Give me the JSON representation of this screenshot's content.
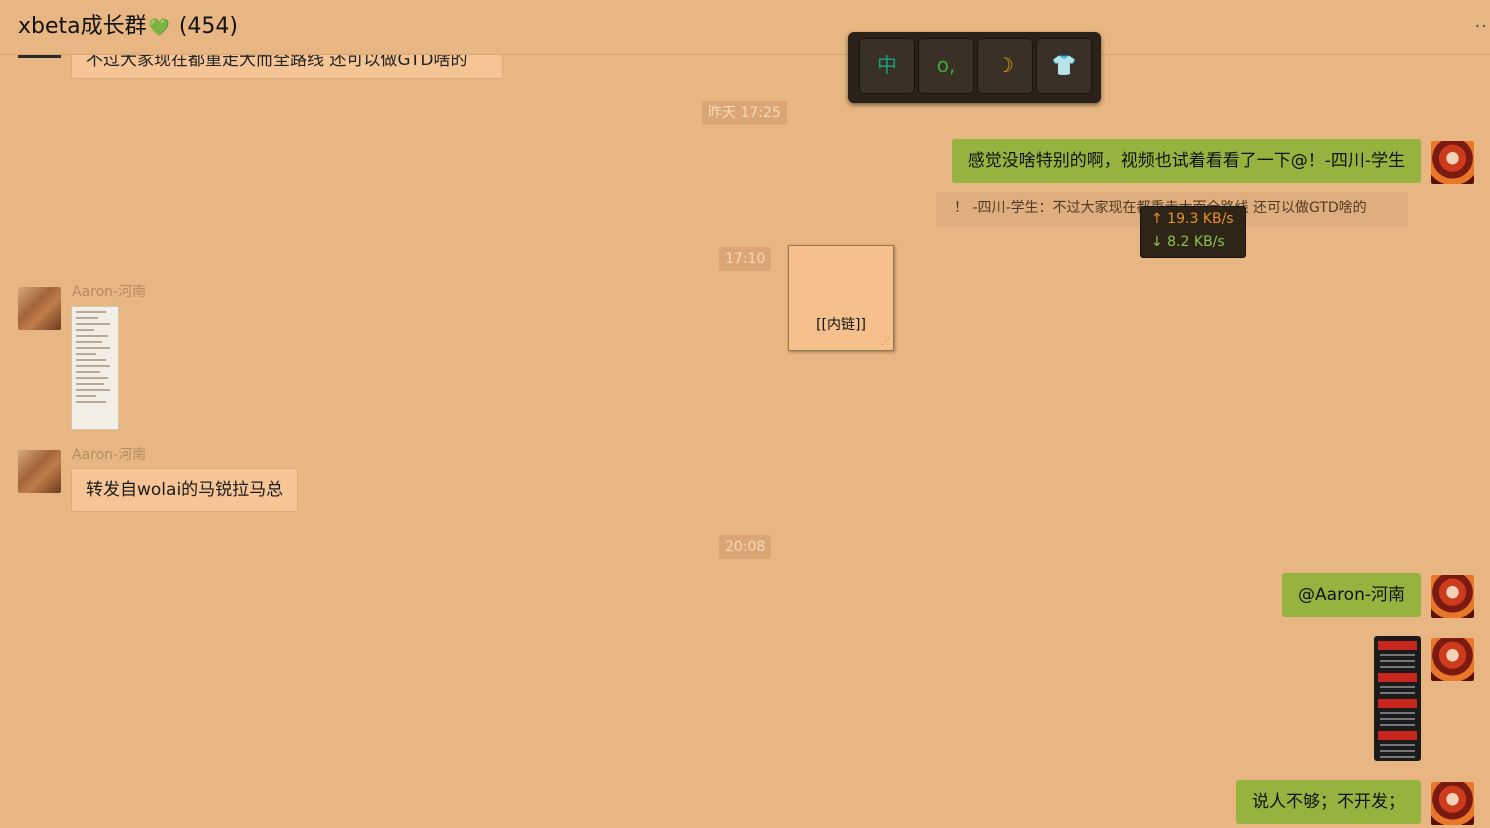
{
  "header": {
    "title": "xbeta成长群",
    "heart_glyph": "💚",
    "count": "(454)",
    "more_glyph": "··"
  },
  "peek_message": {
    "text": "不过大家现在都重走大而全路线 还可以做GTD啥的"
  },
  "timestamps": [
    "昨天 17:25",
    "17:10",
    "20:08"
  ],
  "messages": [
    {
      "side": "right",
      "text": "感觉没啥特别的啊，视频也试着看看了一下@！-四川-学生"
    },
    {
      "side": "right",
      "type": "quote",
      "text": "！ -四川-学生：不过大家现在都重走大而全路线 还可以做GTD啥的"
    },
    {
      "side": "left",
      "sender": "Aaron-河南",
      "type": "image-document"
    },
    {
      "side": "left",
      "sender": "Aaron-河南",
      "text": "转发自wolai的马锐拉马总"
    },
    {
      "side": "right",
      "text": "@Aaron-河南"
    },
    {
      "side": "right",
      "type": "image-screenshot"
    },
    {
      "side": "right",
      "text": "说人不够；不开发；"
    }
  ],
  "sticky_note": {
    "text": "[[内链]]"
  },
  "ime_toolbar": {
    "buttons": [
      {
        "label": "中",
        "color": "#13a07a"
      },
      {
        "label": "o,",
        "color": "#3fa83a"
      },
      {
        "label": "☽",
        "color": "#d9a614"
      },
      {
        "label": "👕",
        "color": "#13a07a"
      }
    ]
  },
  "net_speed": {
    "up": "↑ 19.3 KB/s",
    "down": "↓ 8.2 KB/s"
  },
  "colors": {
    "background": "#e8b682",
    "bubble_self": "#95b33e",
    "bubble_other": "#f6c596"
  }
}
